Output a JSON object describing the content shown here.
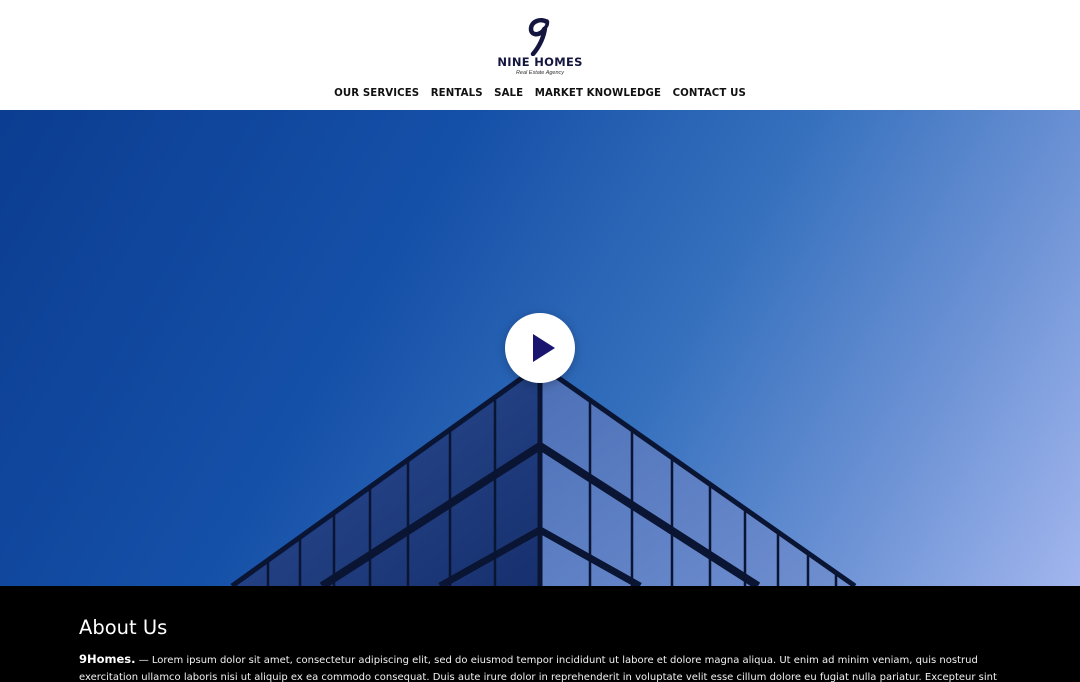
{
  "brand": {
    "name": "NINE HOMES",
    "tagline": "Real Estate Agency",
    "logo_mark": "9"
  },
  "nav": {
    "items": [
      {
        "label": "OUR SERVICES"
      },
      {
        "label": "RENTALS"
      },
      {
        "label": "SALE"
      },
      {
        "label": "MARKET KNOWLEDGE"
      },
      {
        "label": "CONTACT US"
      }
    ]
  },
  "hero": {
    "play_icon": "play-icon",
    "play_color": "#1a1670"
  },
  "about": {
    "title": "About Us",
    "brand": "9Homes.",
    "text": " — Lorem ipsum dolor sit amet, consectetur adipiscing elit, sed do eiusmod tempor incididunt ut labore et dolore magna aliqua. Ut enim ad minim veniam, quis nostrud exercitation ullamco laboris nisi ut aliquip ex ea commodo consequat. Duis aute irure dolor in reprehenderit in voluptate velit esse cillum dolore eu fugiat nulla pariatur. Excepteur sint occaecat cupidatat non proident, sunt in"
  },
  "colors": {
    "brand_navy": "#15163f",
    "hero_blue": "#1550a8",
    "about_bg": "#000000"
  }
}
